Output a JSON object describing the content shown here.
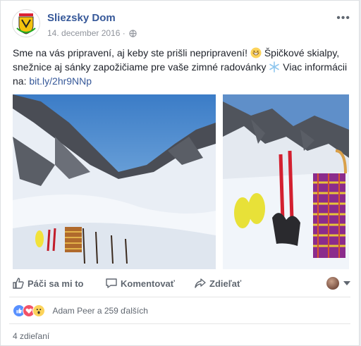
{
  "post": {
    "page_name": "Sliezsky Dom",
    "date": "14. december 2016",
    "meta_sep": "·",
    "privacy_icon": "globe-icon",
    "more_icon": "more-icon",
    "text_line1": "Sme na vás pripravení, aj keby ste prišli nepripravení! ",
    "text_line1b": " Špičkové skialpy,",
    "text_line2": "snežnice aj sánky zapožičiame pre vaše zimné radovánky ",
    "text_line2b": " Viac informácii",
    "text_line3": "na: ",
    "link": "bit.ly/2hr9NNp",
    "emoji1": "grinning-face-icon",
    "emoji2": "snowflake-icon"
  },
  "actions": {
    "like": "Páči sa mi to",
    "comment": "Komentovať",
    "share": "Zdieľať"
  },
  "reactions": {
    "types": [
      "like",
      "love",
      "wow"
    ],
    "summary": "Adam Peer a 259 ďalších"
  },
  "shares": "4 zdieľaní",
  "colors": {
    "link": "#365899",
    "muted": "#606770",
    "like": "#5890ff",
    "love": "#f25268",
    "wow": "#fcd35a"
  }
}
